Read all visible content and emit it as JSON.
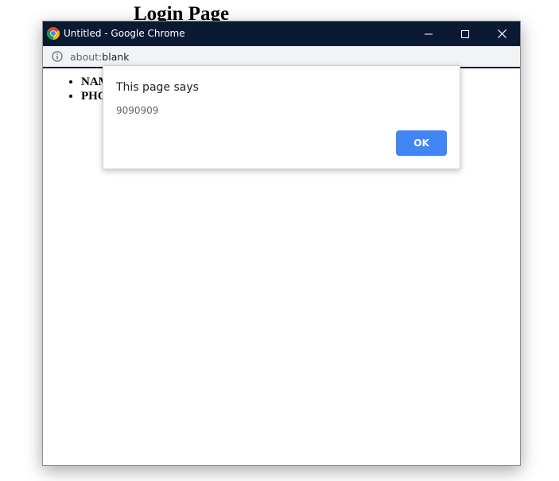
{
  "background_page": {
    "heading": "Login Page"
  },
  "window": {
    "title": "Untitled - Google Chrome",
    "controls": {
      "minimize_icon": "minimize-icon",
      "maximize_icon": "maximize-icon",
      "close_icon": "close-icon"
    },
    "app_icon": "chrome-logo-icon"
  },
  "address_bar": {
    "icon": "info-icon",
    "url_scheme": "about:",
    "url_path": "blank"
  },
  "content": {
    "list_items": [
      "NAME",
      "PHONE"
    ]
  },
  "alert": {
    "title": "This page says",
    "message": "9090909",
    "ok_label": "OK"
  },
  "colors": {
    "title_bar": "#0b1a33",
    "ok_button": "#4285f4",
    "address_bar": "#f1f3f4"
  }
}
